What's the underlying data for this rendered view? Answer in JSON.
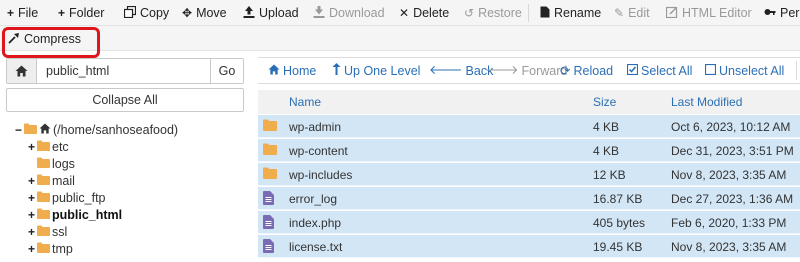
{
  "toolbar": {
    "file": "File",
    "folder": "Folder",
    "copy": "Copy",
    "move": "Move",
    "upload": "Upload",
    "download": "Download",
    "delete": "Delete",
    "restore": "Restore",
    "rename": "Rename",
    "edit": "Edit",
    "html_editor": "HTML Editor",
    "permissions": "Perm",
    "compress": "Compress"
  },
  "path_bar": {
    "value": "public_html",
    "go_label": "Go"
  },
  "collapse_all_label": "Collapse All",
  "tree": {
    "root_label": "(/home/sanhoseafood)",
    "items": [
      {
        "label": "etc",
        "expander": "+"
      },
      {
        "label": "logs",
        "expander": ""
      },
      {
        "label": "mail",
        "expander": "+"
      },
      {
        "label": "public_ftp",
        "expander": "+"
      },
      {
        "label": "public_html",
        "expander": "+"
      },
      {
        "label": "ssl",
        "expander": "+"
      },
      {
        "label": "tmp",
        "expander": "+"
      }
    ]
  },
  "nav": {
    "home": "Home",
    "up_one_level": "Up One Level",
    "back": "Back",
    "forward": "Forward",
    "reload": "Reload",
    "select_all": "Select All",
    "unselect_all": "Unselect All"
  },
  "table": {
    "columns": {
      "name": "Name",
      "size": "Size",
      "modified": "Last Modified"
    },
    "rows": [
      {
        "type": "folder",
        "name": "wp-admin",
        "size": "4 KB",
        "modified": "Oct 6, 2023, 10:12 AM"
      },
      {
        "type": "folder",
        "name": "wp-content",
        "size": "4 KB",
        "modified": "Dec 31, 2023, 3:51 PM"
      },
      {
        "type": "folder",
        "name": "wp-includes",
        "size": "12 KB",
        "modified": "Nov 8, 2023, 3:35 AM"
      },
      {
        "type": "file",
        "name": "error_log",
        "size": "16.87 KB",
        "modified": "Dec 27, 2023, 1:36 AM"
      },
      {
        "type": "file",
        "name": "index.php",
        "size": "405 bytes",
        "modified": "Feb 6, 2020, 1:33 PM"
      },
      {
        "type": "file",
        "name": "license.txt",
        "size": "19.45 KB",
        "modified": "Nov 8, 2023, 3:35 AM"
      }
    ]
  },
  "colors": {
    "folder": "#f0ad4e",
    "file": "#7b6bb5",
    "link": "#2a6fb5",
    "row_selected": "#d3e6f6",
    "highlight": "#e0161d"
  }
}
